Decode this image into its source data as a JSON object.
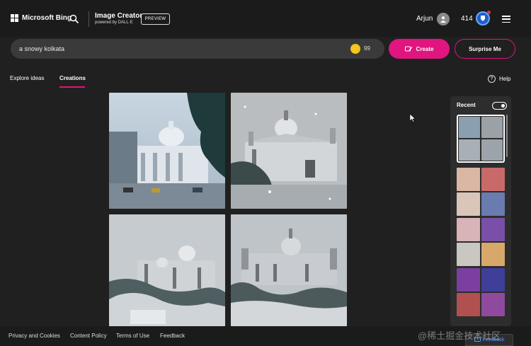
{
  "header": {
    "brand": "Microsoft Bing",
    "product_title": "Image Creator",
    "product_subtitle": "powered by DALL·E",
    "badge": "PREVIEW",
    "user_name": "Arjun",
    "points": "414"
  },
  "prompt": {
    "value": "a snowy kolkata",
    "boosts": "99",
    "create_label": "Create",
    "surprise_label": "Surprise Me"
  },
  "tabs": [
    {
      "label": "Explore ideas",
      "active": false
    },
    {
      "label": "Creations",
      "active": true
    }
  ],
  "help_label": "Help",
  "recent": {
    "title": "Recent",
    "toggle_on": true
  },
  "footer": {
    "links": [
      "Privacy and Cookies",
      "Content Policy",
      "Terms of Use",
      "Feedback"
    ],
    "feedback_button": "Feedback"
  },
  "watermark": "@稀土掘金技术社区",
  "colors": {
    "accent": "#e0157f",
    "background": "#202020",
    "header": "#1b1b1b",
    "input": "#3a3a3a"
  },
  "icons": [
    "windows-logo-icon",
    "search-icon",
    "user-avatar-icon",
    "rewards-icon",
    "hamburger-menu-icon",
    "create-icon",
    "help-icon",
    "toggle-icon",
    "feedback-icon"
  ]
}
